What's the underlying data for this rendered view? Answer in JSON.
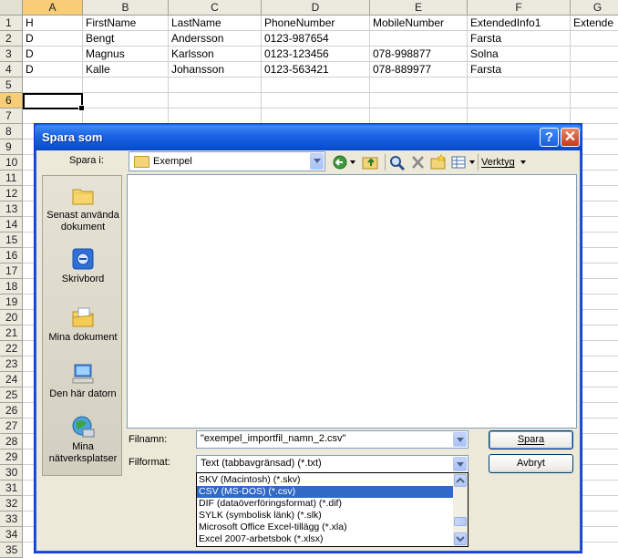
{
  "spreadsheet": {
    "columns": [
      "A",
      "B",
      "C",
      "D",
      "E",
      "F",
      "G"
    ],
    "selected_column": "A",
    "rows": [
      "1",
      "2",
      "3",
      "4",
      "5",
      "6",
      "7",
      "8",
      "9",
      "10",
      "11",
      "12",
      "13",
      "14",
      "15",
      "16",
      "17",
      "18",
      "19",
      "20",
      "21",
      "22",
      "23",
      "24",
      "25",
      "26",
      "27",
      "28",
      "29",
      "30",
      "31",
      "32",
      "33",
      "34",
      "35"
    ],
    "selected_row": "6",
    "cells": [
      [
        "H",
        "FirstName",
        "LastName",
        "PhoneNumber",
        "MobileNumber",
        "ExtendedInfo1",
        "Extende"
      ],
      [
        "D",
        "Bengt",
        "Andersson",
        "0123-987654",
        "",
        "Farsta",
        ""
      ],
      [
        "D",
        "Magnus",
        "Karlsson",
        "0123-123456",
        "078-998877",
        "Solna",
        ""
      ],
      [
        "D",
        "Kalle",
        "Johansson",
        "0123-563421",
        "078-889977",
        "Farsta",
        ""
      ]
    ]
  },
  "dialog": {
    "title": "Spara som",
    "help_label": "?",
    "close_label": "✕",
    "save_in_label": "Spara i:",
    "save_in_value": "Exempel",
    "tools_label": "Verktyg",
    "places": [
      "Senast använda dokument",
      "Skrivbord",
      "Mina dokument",
      "Den här datorn",
      "Mina nätverksplatser"
    ],
    "filename_label": "Filnamn:",
    "filename_value": "\"exempel_importfil_namn_2.csv\"",
    "fileformat_label": "Filformat:",
    "fileformat_value": "Text (tabbavgränsad) (*.txt)",
    "save_button": "Spara",
    "cancel_button": "Avbryt",
    "format_options": [
      "SKV (Macintosh) (*.skv)",
      "CSV (MS-DOS) (*.csv)",
      "DIF (dataöverföringsformat) (*.dif)",
      "SYLK (symbolisk länk) (*.slk)",
      "Microsoft Office Excel-tillägg (*.xla)",
      "Excel 2007-arbetsbok (*.xlsx)"
    ],
    "highlighted_option": "CSV (MS-DOS) (*.csv)"
  },
  "colors": {
    "titlebar": "#1d66e6",
    "highlight": "#316ac5",
    "selected_header": "#f7cd77"
  }
}
